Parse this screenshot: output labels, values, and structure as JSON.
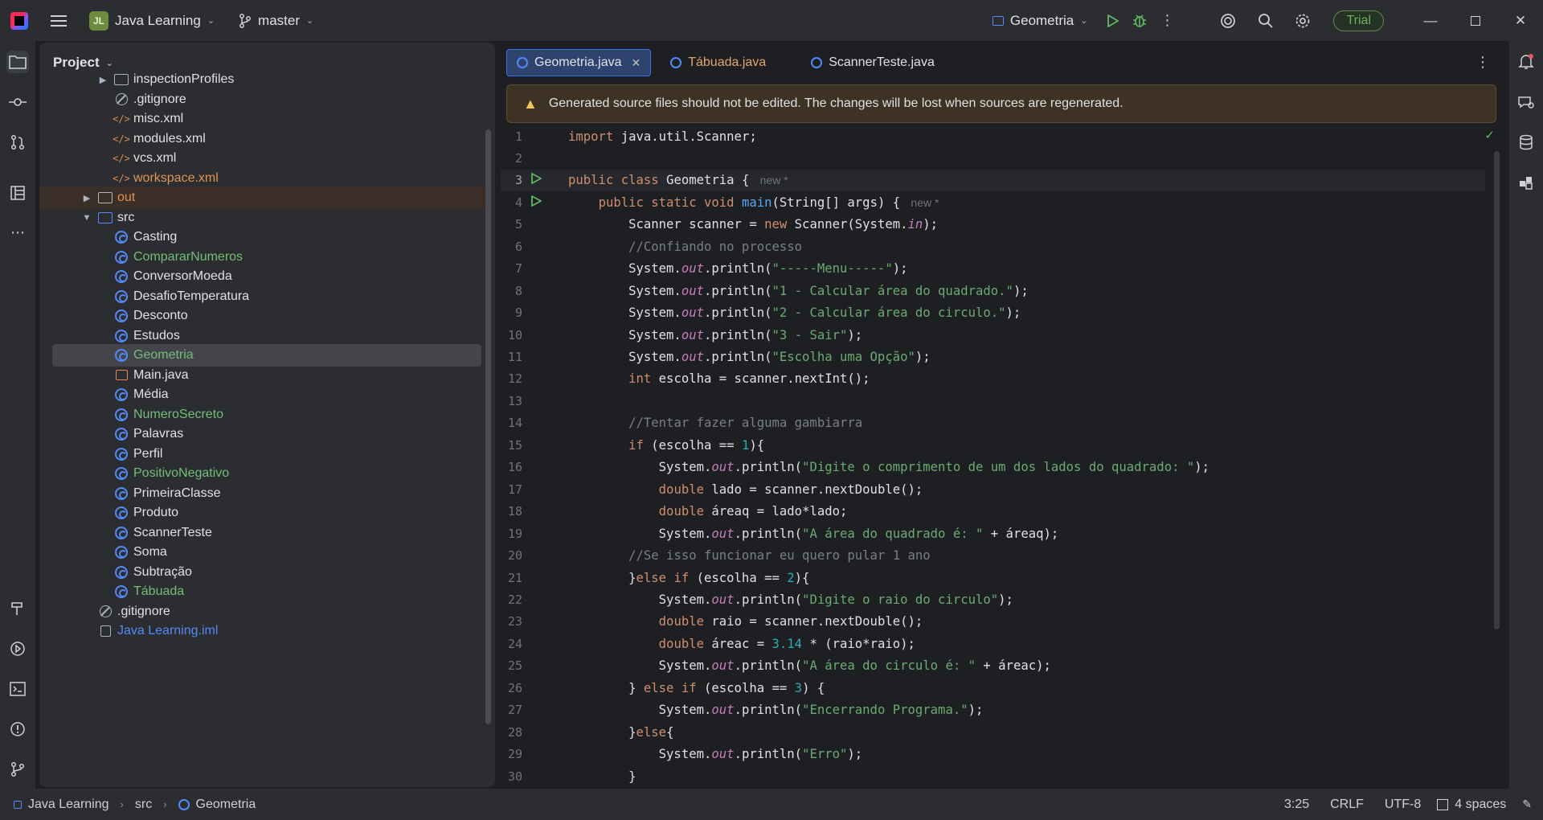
{
  "topbar": {
    "project_initials": "JL",
    "project_name": "Java Learning",
    "branch": "master",
    "run_config": "Geometria",
    "trial_label": "Trial"
  },
  "project_panel": {
    "title": "Project",
    "rows": [
      {
        "label": "inspectionProfiles",
        "type": "folder",
        "indent": 3,
        "twisty": "▶",
        "color": "default"
      },
      {
        "label": ".gitignore",
        "type": "ignore",
        "indent": 3,
        "color": "default"
      },
      {
        "label": "misc.xml",
        "type": "xml",
        "indent": 3,
        "color": "default"
      },
      {
        "label": "modules.xml",
        "type": "xml",
        "indent": 3,
        "color": "default"
      },
      {
        "label": "vcs.xml",
        "type": "xml",
        "indent": 3,
        "color": "default"
      },
      {
        "label": "workspace.xml",
        "type": "xml",
        "indent": 3,
        "color": "orange"
      },
      {
        "label": "out",
        "type": "folder",
        "indent": 2,
        "twisty": "▶",
        "color": "orange",
        "excluded": true
      },
      {
        "label": "src",
        "type": "srcfolder",
        "indent": 2,
        "twisty": "▼",
        "color": "default"
      },
      {
        "label": "Casting",
        "type": "class",
        "indent": 3,
        "color": "default"
      },
      {
        "label": "CompararNumeros",
        "type": "class",
        "indent": 3,
        "color": "green"
      },
      {
        "label": "ConversorMoeda",
        "type": "class",
        "indent": 3,
        "color": "default"
      },
      {
        "label": "DesafioTemperatura",
        "type": "class",
        "indent": 3,
        "color": "default"
      },
      {
        "label": "Desconto",
        "type": "class",
        "indent": 3,
        "color": "default"
      },
      {
        "label": "Estudos",
        "type": "class",
        "indent": 3,
        "color": "default"
      },
      {
        "label": "Geometria",
        "type": "class",
        "indent": 3,
        "color": "green",
        "selected": true
      },
      {
        "label": "Main.java",
        "type": "java",
        "indent": 3,
        "color": "default"
      },
      {
        "label": "Média",
        "type": "class",
        "indent": 3,
        "color": "default"
      },
      {
        "label": "NumeroSecreto",
        "type": "class",
        "indent": 3,
        "color": "green"
      },
      {
        "label": "Palavras",
        "type": "class",
        "indent": 3,
        "color": "default"
      },
      {
        "label": "Perfil",
        "type": "class",
        "indent": 3,
        "color": "default"
      },
      {
        "label": "PositivoNegativo",
        "type": "class",
        "indent": 3,
        "color": "green"
      },
      {
        "label": "PrimeiraClasse",
        "type": "class",
        "indent": 3,
        "color": "default"
      },
      {
        "label": "Produto",
        "type": "class",
        "indent": 3,
        "color": "default"
      },
      {
        "label": "ScannerTeste",
        "type": "class",
        "indent": 3,
        "color": "default"
      },
      {
        "label": "Soma",
        "type": "class",
        "indent": 3,
        "color": "default"
      },
      {
        "label": "Subtração",
        "type": "class",
        "indent": 3,
        "color": "default"
      },
      {
        "label": "Tábuada",
        "type": "class",
        "indent": 3,
        "color": "green"
      },
      {
        "label": ".gitignore",
        "type": "ignore",
        "indent": 2,
        "color": "default"
      },
      {
        "label": "Java Learning.iml",
        "type": "iml",
        "indent": 2,
        "color": "blue"
      }
    ]
  },
  "editor": {
    "tabs": [
      {
        "label": "Geometria.java",
        "active": true,
        "color": "default"
      },
      {
        "label": "Tábuada.java",
        "active": false,
        "color": "orange"
      },
      {
        "label": "ScannerTeste.java",
        "active": false,
        "color": "default"
      }
    ],
    "banner": "Generated source files should not be edited. The changes will be lost when sources are regenerated.",
    "lines": [
      {
        "n": "1",
        "html": "<span class='kw'>import</span> java.util.Scanner;"
      },
      {
        "n": "2",
        "html": ""
      },
      {
        "n": "3",
        "run": true,
        "cur": true,
        "html": "<span class='kw'>public class</span> Geometria { <span class='hint'> new *</span>"
      },
      {
        "n": "4",
        "run": true,
        "html": "    <span class='kw'>public static void</span> <span class='fn'>main</span>(String[] args) { <span class='hint'> new *</span>"
      },
      {
        "n": "5",
        "html": "        Scanner scanner = <span class='kw'>new</span> Scanner(System.<span class='st'>in</span>);"
      },
      {
        "n": "6",
        "html": "        <span class='cm'>//Confiando no processo</span>"
      },
      {
        "n": "7",
        "html": "        System.<span class='st'>out</span>.println(<span class='str'>\"-----Menu-----\"</span>);"
      },
      {
        "n": "8",
        "html": "        System.<span class='st'>out</span>.println(<span class='str'>\"1 - Calcular área do quadrado.\"</span>);"
      },
      {
        "n": "9",
        "html": "        System.<span class='st'>out</span>.println(<span class='str'>\"2 - Calcular área do circulo.\"</span>);"
      },
      {
        "n": "10",
        "html": "        System.<span class='st'>out</span>.println(<span class='str'>\"3 - Sair\"</span>);"
      },
      {
        "n": "11",
        "html": "        System.<span class='st'>out</span>.println(<span class='str'>\"Escolha uma Opção\"</span>);"
      },
      {
        "n": "12",
        "html": "        <span class='kw'>int</span> escolha = scanner.nextInt();"
      },
      {
        "n": "13",
        "html": ""
      },
      {
        "n": "14",
        "html": "        <span class='cm'>//Tentar fazer alguma gambiarra</span>"
      },
      {
        "n": "15",
        "html": "        <span class='kw'>if</span> (escolha == <span class='num'>1</span>){"
      },
      {
        "n": "16",
        "html": "            System.<span class='st'>out</span>.println(<span class='str'>\"Digite o comprimento de um dos lados do quadrado: \"</span>);"
      },
      {
        "n": "17",
        "html": "            <span class='kw'>double</span> lado = scanner.nextDouble();"
      },
      {
        "n": "18",
        "html": "            <span class='kw'>double</span> áreaq = lado*lado;"
      },
      {
        "n": "19",
        "html": "            System.<span class='st'>out</span>.println(<span class='str'>\"A área do quadrado é: \"</span> + áreaq);"
      },
      {
        "n": "20",
        "html": "        <span class='cm'>//Se isso funcionar eu quero pular 1 ano</span>"
      },
      {
        "n": "21",
        "html": "        }<span class='kw'>else if</span> (escolha == <span class='num'>2</span>){"
      },
      {
        "n": "22",
        "html": "            System.<span class='st'>out</span>.println(<span class='str'>\"Digite o raio do circulo\"</span>);"
      },
      {
        "n": "23",
        "html": "            <span class='kw'>double</span> raio = scanner.nextDouble();"
      },
      {
        "n": "24",
        "html": "            <span class='kw'>double</span> áreac = <span class='num'>3.14</span> * (raio*raio);"
      },
      {
        "n": "25",
        "html": "            System.<span class='st'>out</span>.println(<span class='str'>\"A área do circulo é: \"</span> + áreac);"
      },
      {
        "n": "26",
        "html": "        } <span class='kw'>else if</span> (escolha == <span class='num'>3</span>) {"
      },
      {
        "n": "27",
        "html": "            System.<span class='st'>out</span>.println(<span class='str'>\"Encerrando Programa.\"</span>);"
      },
      {
        "n": "28",
        "html": "        }<span class='kw'>else</span>{"
      },
      {
        "n": "29",
        "html": "            System.<span class='st'>out</span>.println(<span class='str'>\"Erro\"</span>);"
      },
      {
        "n": "30",
        "html": "        }"
      }
    ]
  },
  "statusbar": {
    "crumb_project": "Java Learning",
    "crumb_src": "src",
    "crumb_class": "Geometria",
    "position": "3:25",
    "line_sep": "CRLF",
    "encoding": "UTF-8",
    "indent": "4 spaces"
  }
}
